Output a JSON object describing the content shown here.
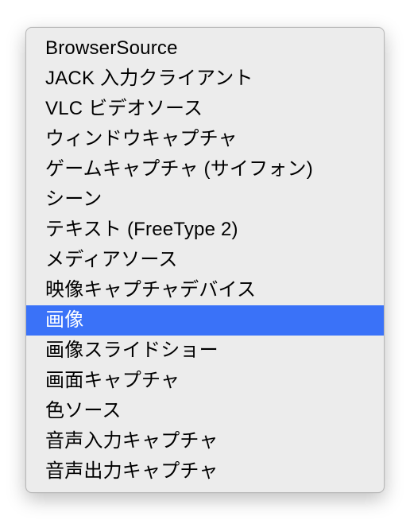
{
  "menu": {
    "items": [
      {
        "label": "BrowserSource",
        "selected": false
      },
      {
        "label": "JACK 入力クライアント",
        "selected": false
      },
      {
        "label": "VLC ビデオソース",
        "selected": false
      },
      {
        "label": "ウィンドウキャプチャ",
        "selected": false
      },
      {
        "label": "ゲームキャプチャ (サイフォン)",
        "selected": false
      },
      {
        "label": "シーン",
        "selected": false
      },
      {
        "label": "テキスト (FreeType 2)",
        "selected": false
      },
      {
        "label": "メディアソース",
        "selected": false
      },
      {
        "label": "映像キャプチャデバイス",
        "selected": false
      },
      {
        "label": "画像",
        "selected": true
      },
      {
        "label": "画像スライドショー",
        "selected": false
      },
      {
        "label": "画面キャプチャ",
        "selected": false
      },
      {
        "label": "色ソース",
        "selected": false
      },
      {
        "label": "音声入力キャプチャ",
        "selected": false
      },
      {
        "label": "音声出力キャプチャ",
        "selected": false
      }
    ]
  }
}
